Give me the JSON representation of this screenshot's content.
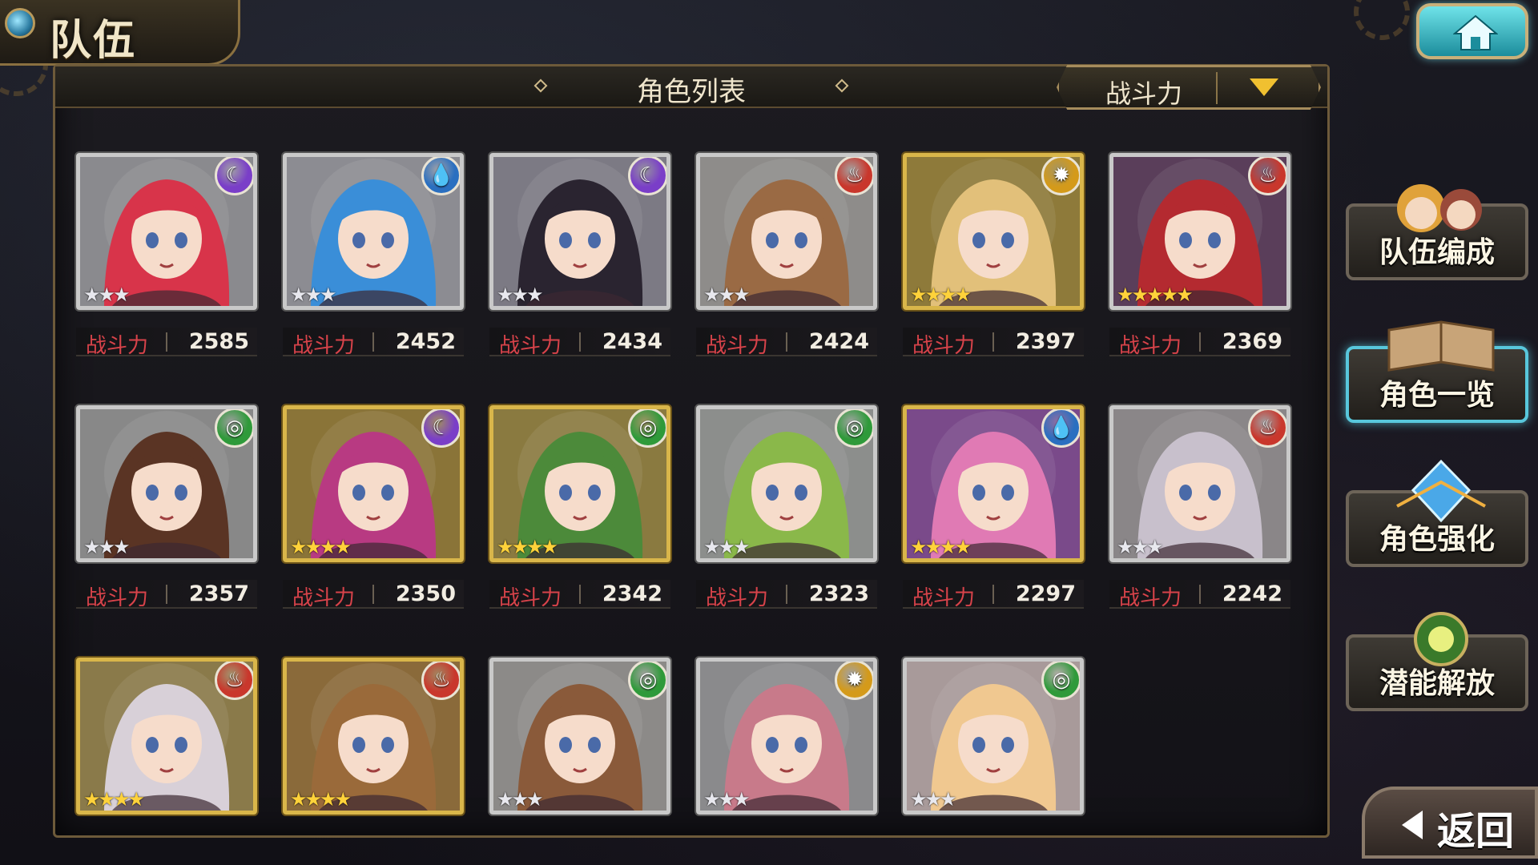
{
  "header": {
    "title": "队伍"
  },
  "panel": {
    "title": "角色列表",
    "sort_label": "战斗力"
  },
  "power_label": "战斗力",
  "colors": {
    "fire": "#c9372c",
    "water": "#2a6fc0",
    "dark": "#7a3ec8",
    "wind": "#2f9a3a",
    "light": "#d49a1a"
  },
  "cards": [
    {
      "power": "2585",
      "element": "dark",
      "rarity": 3,
      "frame": "silver",
      "hair": "#d8344a",
      "bg": "#8a8a8e"
    },
    {
      "power": "2452",
      "element": "water",
      "rarity": 3,
      "frame": "silver",
      "hair": "#3a8ed8",
      "bg": "#8c8c92"
    },
    {
      "power": "2434",
      "element": "dark",
      "rarity": 3,
      "frame": "silver",
      "hair": "#2a2430",
      "bg": "#7c7a84"
    },
    {
      "power": "2424",
      "element": "fire",
      "rarity": 3,
      "frame": "silver",
      "hair": "#9a6a44",
      "bg": "#8e8c8a"
    },
    {
      "power": "2397",
      "element": "light",
      "rarity": 4,
      "frame": "gold",
      "hair": "#e2c07a",
      "bg": "#8e7a3a"
    },
    {
      "power": "2369",
      "element": "fire",
      "rarity": 5,
      "frame": "silver",
      "hair": "#b42a30",
      "bg": "#5a3e5a"
    },
    {
      "power": "2357",
      "element": "wind",
      "rarity": 3,
      "frame": "silver",
      "hair": "#5a3424",
      "bg": "#888888"
    },
    {
      "power": "2350",
      "element": "dark",
      "rarity": 4,
      "frame": "gold",
      "hair": "#b83a82",
      "bg": "#8a7438"
    },
    {
      "power": "2342",
      "element": "wind",
      "rarity": 4,
      "frame": "gold",
      "hair": "#4c8a3a",
      "bg": "#8a7a40"
    },
    {
      "power": "2323",
      "element": "wind",
      "rarity": 3,
      "frame": "silver",
      "hair": "#8ab84a",
      "bg": "#8c8e8c"
    },
    {
      "power": "2297",
      "element": "water",
      "rarity": 4,
      "frame": "gold",
      "hair": "#e07ab4",
      "bg": "#7a4a8a"
    },
    {
      "power": "2242",
      "element": "fire",
      "rarity": 3,
      "frame": "silver",
      "hair": "#c8c0cc",
      "bg": "#8a8688"
    },
    {
      "power": "",
      "element": "fire",
      "rarity": 4,
      "frame": "gold",
      "hair": "#d8d0d8",
      "bg": "#8a7a4a"
    },
    {
      "power": "",
      "element": "fire",
      "rarity": 4,
      "frame": "gold",
      "hair": "#9a6a3a",
      "bg": "#8a6a3a"
    },
    {
      "power": "",
      "element": "wind",
      "rarity": 3,
      "frame": "silver",
      "hair": "#8a5a3a",
      "bg": "#8c8a88"
    },
    {
      "power": "",
      "element": "light",
      "rarity": 3,
      "frame": "silver",
      "hair": "#c87a8a",
      "bg": "#8a8a8c"
    },
    {
      "power": "",
      "element": "wind",
      "rarity": 3,
      "frame": "silver",
      "hair": "#f0c890",
      "bg": "#a89a9a"
    }
  ],
  "side_menu": [
    {
      "label": "队伍编成",
      "active": false,
      "icon": "party-icon"
    },
    {
      "label": "角色一览",
      "active": true,
      "icon": "book-icon"
    },
    {
      "label": "角色强化",
      "active": false,
      "icon": "crystal-icon"
    },
    {
      "label": "潜能解放",
      "active": false,
      "icon": "orb-icon"
    }
  ],
  "back": {
    "label": "返回"
  }
}
